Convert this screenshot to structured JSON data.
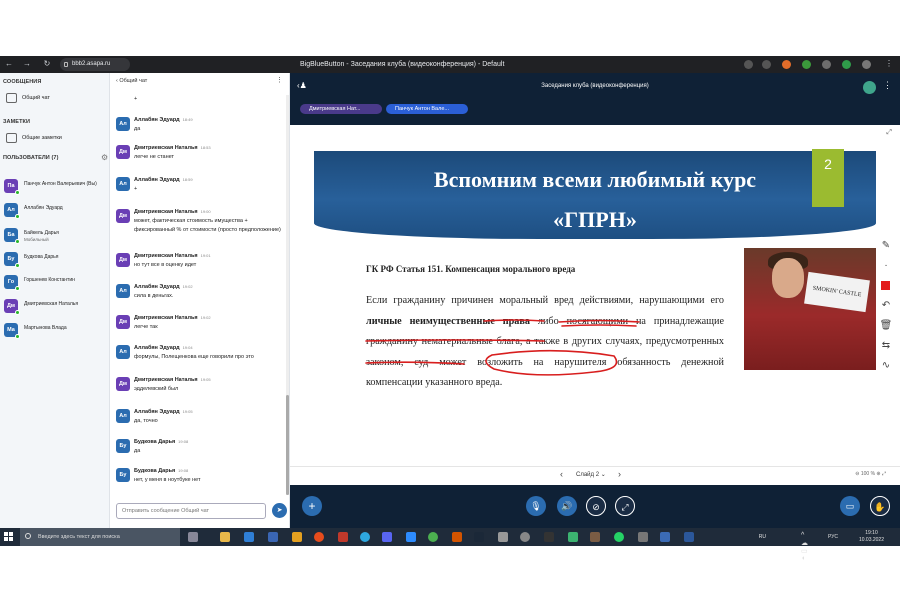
{
  "browser": {
    "url": "bbb2.asapa.ru",
    "window_title": "BigBlueButton - Заседания клуба (видеоконференция) - Default"
  },
  "sidebar": {
    "messages_title": "СООБЩЕНИЯ",
    "public_chat": "Общий чат",
    "notes_title": "ЗАМЕТКИ",
    "shared_notes": "Общие заметки",
    "users_title": "ПОЛЬЗОВАТЕЛИ (7)",
    "users": [
      {
        "initials": "Па",
        "name": "Панчук Антон Валерьевич (Вы)",
        "sub": "",
        "color": "#6a3fb5"
      },
      {
        "initials": "Ал",
        "name": "Аллабян Эдуард",
        "sub": "",
        "color": "#2b6cb0"
      },
      {
        "initials": "Ба",
        "name": "Байкель Дарья",
        "sub": "Мобильный",
        "color": "#2b6cb0"
      },
      {
        "initials": "Бу",
        "name": "Будкова Дарья",
        "sub": "",
        "color": "#2b6cb0"
      },
      {
        "initials": "Го",
        "name": "Горшенев Константин",
        "sub": "",
        "color": "#2b6cb0"
      },
      {
        "initials": "Дм",
        "name": "Дмитриевская Наталья",
        "sub": "",
        "color": "#6a3fb5"
      },
      {
        "initials": "Ма",
        "name": "Мартынова Влада",
        "sub": "",
        "color": "#2b6cb0"
      }
    ]
  },
  "chat": {
    "back_label": "Общий чат",
    "input_placeholder": "Отправить сообщение Общий чат",
    "messages": [
      {
        "initials": "",
        "name": "",
        "time": "",
        "text": "+"
      },
      {
        "initials": "Ал",
        "name": "Аллабян Эдуард",
        "time": "18:49",
        "text": "да"
      },
      {
        "initials": "Дм",
        "name": "Дмитриевская Наталья",
        "time": "18:53",
        "text": "легче не станет"
      },
      {
        "initials": "Ал",
        "name": "Аллабян Эдуард",
        "time": "18:59",
        "text": "+"
      },
      {
        "initials": "Дм",
        "name": "Дмитриевская Наталья",
        "time": "19:00",
        "text": "может, фактическая стоимость имущества + фиксированный % от стоимости (просто предположение)"
      },
      {
        "initials": "Дм",
        "name": "Дмитриевская Наталья",
        "time": "19:01",
        "text": "но тут все в оценку идет"
      },
      {
        "initials": "Ал",
        "name": "Аллабян Эдуард",
        "time": "19:02",
        "text": "сила в деньгах."
      },
      {
        "initials": "Дм",
        "name": "Дмитриевская Наталья",
        "time": "19:02",
        "text": "легче так"
      },
      {
        "initials": "Ал",
        "name": "Аллабян Эдуард",
        "time": "19:04",
        "text": "формулы, Полещенкова еще говорили про это"
      },
      {
        "initials": "Дм",
        "name": "Дмитриевская Наталья",
        "time": "19:05",
        "text": "эдделевский был"
      },
      {
        "initials": "Ал",
        "name": "Аллабян Эдуард",
        "time": "19:05",
        "text": "да, точно"
      },
      {
        "initials": "Бу",
        "name": "Будкова Дарья",
        "time": "19:08",
        "text": "да"
      },
      {
        "initials": "Бу",
        "name": "Будкова Дарья",
        "time": "19:08",
        "text": "нет, у меня в ноутбуке нет"
      }
    ]
  },
  "meeting": {
    "title": "Заседания клуба (видеоконференция)",
    "talkers": [
      "Дмитриевская Нат...",
      "Панчук Антон Вале..."
    ]
  },
  "slide": {
    "title_line1": "Вспомним всеми любимый курс",
    "title_line2": "«ГПРН»",
    "number": "2",
    "heading": "ГК РФ Статья 151. Компенсация морального вреда",
    "body_parts": [
      "Если гражданину причинен моральный вред действиями, нарушающими его ",
      "личные неимущественные права",
      " либо посягающими на принадлежащие гражданину нематериальные блага, а также в других случаях, предусмотренных законом, суд может возложить на нарушителя обязанность денежной компенсации указанного вреда."
    ],
    "photo_sign": "SMOKIN' CASTLE",
    "label": "Слайд 2",
    "zoom": "100 %"
  },
  "taskbar": {
    "search_placeholder": "Введите здесь текст для поиска",
    "lang": "РУС",
    "time": "19:10",
    "date": "10.03.2022",
    "ru": "RU"
  },
  "colors": {
    "accent": "#2b6cb0",
    "meeting_bg": "#0f2136",
    "slide_banner": "#1c4a7a",
    "slide_number_bg": "#9bbb30",
    "annotation": "#d81e1e"
  }
}
